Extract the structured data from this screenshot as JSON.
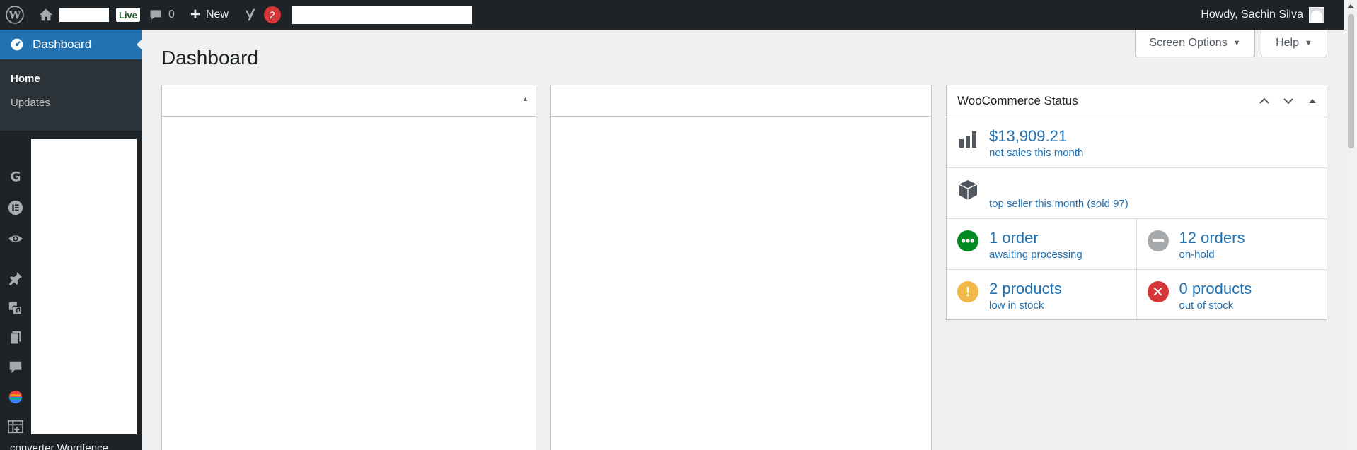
{
  "admin_bar": {
    "live_label": "Live",
    "comments_count": "0",
    "new_label": "New",
    "yoast_badge": "2",
    "howdy": "Howdy, Sachin Silva"
  },
  "sidebar": {
    "dashboard_label": "Dashboard",
    "submenu": [
      {
        "label": "Home"
      },
      {
        "label": "Updates"
      }
    ],
    "icons": [
      "google-icon",
      "elementor-icon",
      "eye-icon",
      "pin-icon",
      "media-icon",
      "pages-icon",
      "comments-icon",
      "color-wheel-icon",
      "table-icon"
    ],
    "bottom_text": "converter Wordfence"
  },
  "main": {
    "screen_options_label": "Screen Options",
    "help_label": "Help",
    "page_title": "Dashboard"
  },
  "woo_status": {
    "title": "WooCommerce Status",
    "net_sales_value": "$13,909.21",
    "net_sales_label": "net sales this month",
    "top_seller_label": "top seller this month (sold 97)",
    "processing_value": "1 order",
    "processing_label": "awaiting processing",
    "onhold_value": "12 orders",
    "onhold_label": "on-hold",
    "lowstock_value": "2 products",
    "lowstock_label": "low in stock",
    "outstock_value": "0 products",
    "outstock_label": "out of stock",
    "colors": {
      "processing": "#008a20",
      "onhold": "#a7aaad",
      "lowstock": "#f0b849",
      "outstock": "#d63638",
      "link": "#2271b1"
    }
  }
}
